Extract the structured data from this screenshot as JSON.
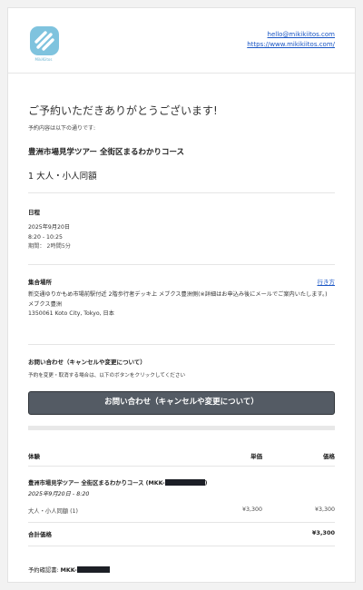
{
  "header": {
    "logo_text": "MikiKiitos",
    "email": "hello@mikikiitos.com",
    "website": "https://www.mikikiitos.com/"
  },
  "intro": {
    "thanks": "ご予約いただきありがとうございます!",
    "subtitle": "予約内容は以下の通りです:",
    "tour_title": "豊洲市場見学ツアー 全街区まるわかりコース",
    "party": "1 大人・小人同額"
  },
  "schedule": {
    "label": "日程",
    "date": "2025年9月20日",
    "time": "8:20 - 10:25",
    "duration": "期間： 2時間5分"
  },
  "meeting": {
    "label": "集合場所",
    "directions_link": "行き方",
    "line1": "新交通ゆりかもめ市場前駅付近 2階歩行者デッキ上 メブクス豊洲側(※詳細はお申込み後にメールでご案内いたします。)",
    "line2": "メブクス豊洲",
    "line3": "1350061 Koto City, Tokyo, 日本"
  },
  "inquiry": {
    "label": "お問い合わせ（キャンセルや変更について）",
    "instruction": "予約を変更・取消する場合は、以下のボタンをクリックしてください",
    "button_label": "お問い合わせ（キャンセルや変更について）"
  },
  "pricing": {
    "col_experience": "体験",
    "col_unit": "単価",
    "col_price": "価格",
    "item_title": "豊洲市場見学ツアー 全街区まるわかりコース (MKK-",
    "item_title_suffix": ")",
    "item_datetime": "2025年9月20日 - 8:20",
    "line_label": "大人・小人同額 (1)",
    "line_unit": "¥3,300",
    "line_price": "¥3,300",
    "total_label": "合計価格",
    "total_value": "¥3,300"
  },
  "footer": {
    "confirmation_label": "予約確認書:",
    "confirmation_prefix": "MKK-"
  },
  "colors": {
    "link": "#1a56c5",
    "button_bg": "#545b64",
    "logo": "#7fc3de"
  }
}
